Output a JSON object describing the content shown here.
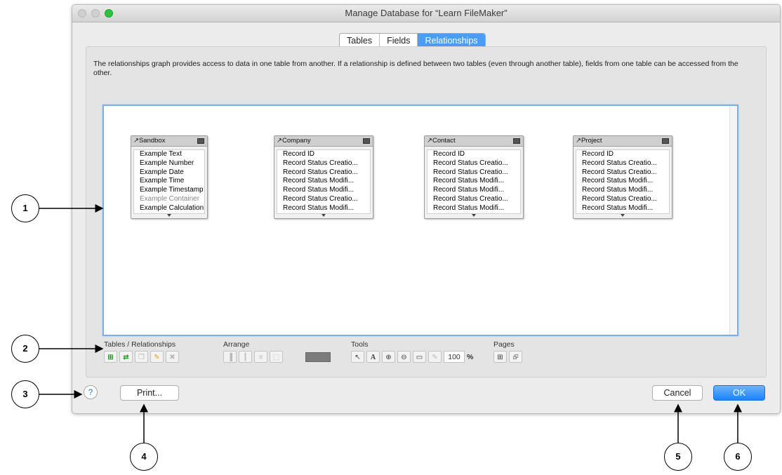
{
  "window": {
    "title": "Manage Database for “Learn FileMaker”"
  },
  "tabs": [
    "Tables",
    "Fields",
    "Relationships"
  ],
  "description": "The relationships graph provides access to data in one table from another. If a relationship is defined between two tables (even through another table), fields from one table can be accessed from the other.",
  "tables": [
    {
      "name": "Sandbox",
      "fields": [
        "Example Text",
        "Example Number",
        "Example Date",
        "Example Time",
        "Example Timestamp",
        "Example Container",
        "Example Calculation"
      ]
    },
    {
      "name": "Company",
      "fields": [
        "Record ID",
        "Record Status Creatio...",
        "Record Status Creatio...",
        "Record Status Modifi...",
        "Record Status Modifi...",
        "Record Status Creatio...",
        "Record Status Modifi..."
      ]
    },
    {
      "name": "Contact",
      "fields": [
        "Record ID",
        "Record Status Creatio...",
        "Record Status Creatio...",
        "Record Status Modifi...",
        "Record Status Modifi...",
        "Record Status Creatio...",
        "Record Status Modifi..."
      ]
    },
    {
      "name": "Project",
      "fields": [
        "Record ID",
        "Record Status Creatio...",
        "Record Status Creatio...",
        "Record Status Modifi...",
        "Record Status Modifi...",
        "Record Status Creatio...",
        "Record Status Modifi..."
      ]
    }
  ],
  "toolbar": {
    "tables_relationships": "Tables / Relationships",
    "arrange": "Arrange",
    "tools": "Tools",
    "pages": "Pages",
    "zoom_value": "100",
    "zoom_unit": "%"
  },
  "buttons": {
    "help": "?",
    "print": "Print...",
    "cancel": "Cancel",
    "ok": "OK"
  },
  "callouts": [
    "1",
    "2",
    "3",
    "4",
    "5",
    "6"
  ],
  "colors": {
    "accent": "#4b9cf5",
    "ok_button": "#1a82fb",
    "traffic_green": "#2ec33f"
  }
}
